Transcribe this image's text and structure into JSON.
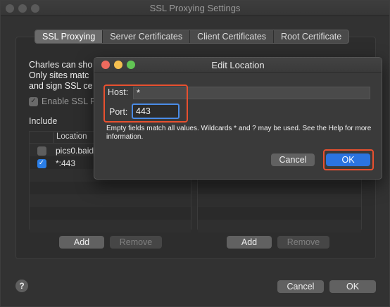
{
  "window": {
    "title": "SSL Proxying Settings"
  },
  "tabs": [
    {
      "label": "SSL Proxying",
      "active": true
    },
    {
      "label": "Server Certificates",
      "active": false
    },
    {
      "label": "Client Certificates",
      "active": false
    },
    {
      "label": "Root Certificate",
      "active": false
    }
  ],
  "description": {
    "line1": "Charles can sho",
    "line2": "Only sites matc",
    "line3": "and sign SSL ce"
  },
  "enable_ssl": {
    "label": "Enable SSL P",
    "checked": true
  },
  "include": {
    "label": "Include",
    "column_header": "Location",
    "rows": [
      {
        "location": "pics0.baid",
        "checked": false
      },
      {
        "location": "*:443",
        "checked": true
      }
    ],
    "add_label": "Add",
    "remove_label": "Remove"
  },
  "exclude": {
    "add_label": "Add",
    "remove_label": "Remove"
  },
  "footer": {
    "help_label": "?",
    "cancel_label": "Cancel",
    "ok_label": "OK"
  },
  "dialog": {
    "title": "Edit Location",
    "host_label": "Host:",
    "host_value": "*",
    "port_label": "Port:",
    "port_value": "443",
    "hint": "Empty fields match all values. Wildcards * and ? may be used. See the Help for more information.",
    "cancel_label": "Cancel",
    "ok_label": "OK"
  },
  "colors": {
    "accent_blue": "#2b74e0",
    "highlight_red": "#e8502f",
    "close_red": "#ed6a5e",
    "minimize_yellow": "#f5bf4f",
    "zoom_green": "#62c554"
  }
}
